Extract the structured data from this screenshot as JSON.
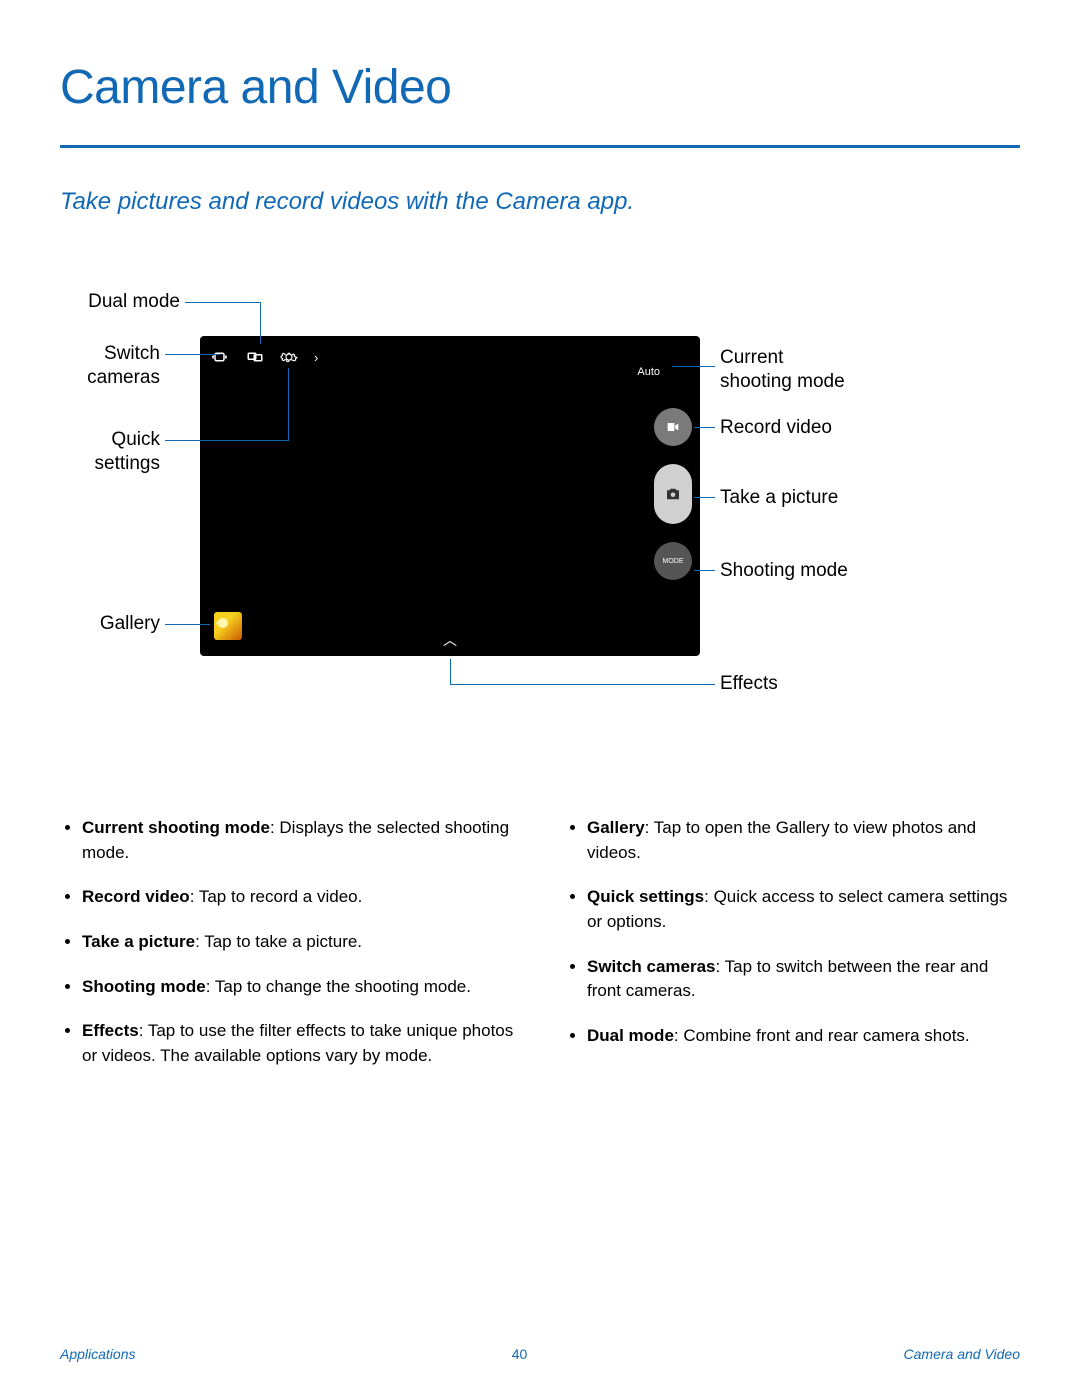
{
  "title": "Camera and Video",
  "subtitle": "Take pictures and record videos with the Camera app.",
  "callouts": {
    "dual_mode": "Dual mode",
    "switch_cameras": "Switch cameras",
    "quick_settings": "Quick settings",
    "gallery": "Gallery",
    "current_mode_l1": "Current",
    "current_mode_l2": "shooting mode",
    "record_video": "Record video",
    "take_picture": "Take a picture",
    "shooting_mode": "Shooting mode",
    "effects": "Effects"
  },
  "screen": {
    "auto": "Auto",
    "mode_btn": "MODE"
  },
  "bullets_left": [
    {
      "term": "Current shooting mode",
      "desc": ": Displays the selected shooting mode."
    },
    {
      "term": "Record video",
      "desc": ": Tap to record a video."
    },
    {
      "term": "Take a picture",
      "desc": ": Tap to take a picture."
    },
    {
      "term": "Shooting mode",
      "desc": ": Tap to change the shooting mode."
    },
    {
      "term": "Effects",
      "desc": ": Tap to use the filter effects to take unique photos or videos. The available options vary by mode."
    }
  ],
  "bullets_right": [
    {
      "term": "Gallery",
      "desc": ": Tap to open the Gallery to view photos and videos."
    },
    {
      "term": "Quick settings",
      "desc": ": Quick access to select camera settings or options."
    },
    {
      "term": "Switch cameras",
      "desc": ": Tap to switch between the rear and front cameras."
    },
    {
      "term": "Dual mode",
      "desc": ": Combine front and rear camera shots."
    }
  ],
  "footer": {
    "left": "Applications",
    "page": "40",
    "right": "Camera and Video"
  }
}
